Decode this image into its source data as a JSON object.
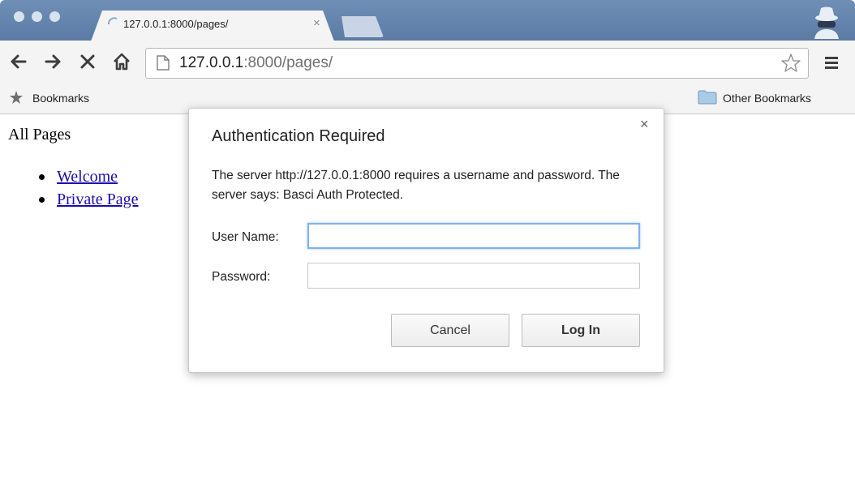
{
  "browser": {
    "tab": {
      "title": "127.0.0.1:8000/pages/",
      "close": "×"
    },
    "address": {
      "host": "127.0.0.1",
      "rest": ":8000/pages/"
    },
    "bookmarks": {
      "label": "Bookmarks",
      "other": "Other Bookmarks"
    }
  },
  "page": {
    "title": "All Pages",
    "links": [
      {
        "label": "Welcome"
      },
      {
        "label": "Private Page"
      }
    ]
  },
  "dialog": {
    "close": "×",
    "title": "Authentication Required",
    "message": "The server http://127.0.0.1:8000 requires a username and password. The server says: Basci Auth Protected.",
    "username_label": "User Name:",
    "username_value": "",
    "password_label": "Password:",
    "password_value": "",
    "cancel_label": "Cancel",
    "login_label": "Log In"
  },
  "colors": {
    "titlebar": "#5a7ba5",
    "focus_ring": "#7fb2ee",
    "link": "#1a0dab"
  }
}
